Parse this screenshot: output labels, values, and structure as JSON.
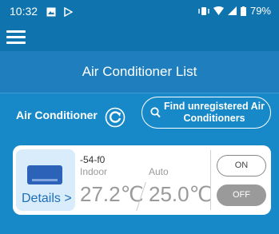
{
  "status_bar": {
    "time": "10:32",
    "battery": "79%"
  },
  "header": {
    "title": "Air Conditioner List"
  },
  "section": {
    "label": "Air Conditioner",
    "find_button": "Find unregistered Air Conditioners"
  },
  "unit": {
    "name": "-54-f0",
    "details_label": "Details >",
    "indoor_label": "Indoor",
    "indoor_temp": "27.2℃",
    "mode_label": "Auto",
    "set_temp": "25.0℃",
    "on_label": "ON",
    "off_label": "OFF"
  },
  "colors": {
    "background": "#1789c8",
    "app_bar": "#0f74ad",
    "card": "#ffffff",
    "off_button": "#9a9a9a",
    "details_link": "#1f6fb8"
  },
  "icons": {
    "menu": "hamburger-menu-icon",
    "refresh": "refresh-icon",
    "search": "search-icon",
    "ac_unit": "air-conditioner-icon"
  }
}
